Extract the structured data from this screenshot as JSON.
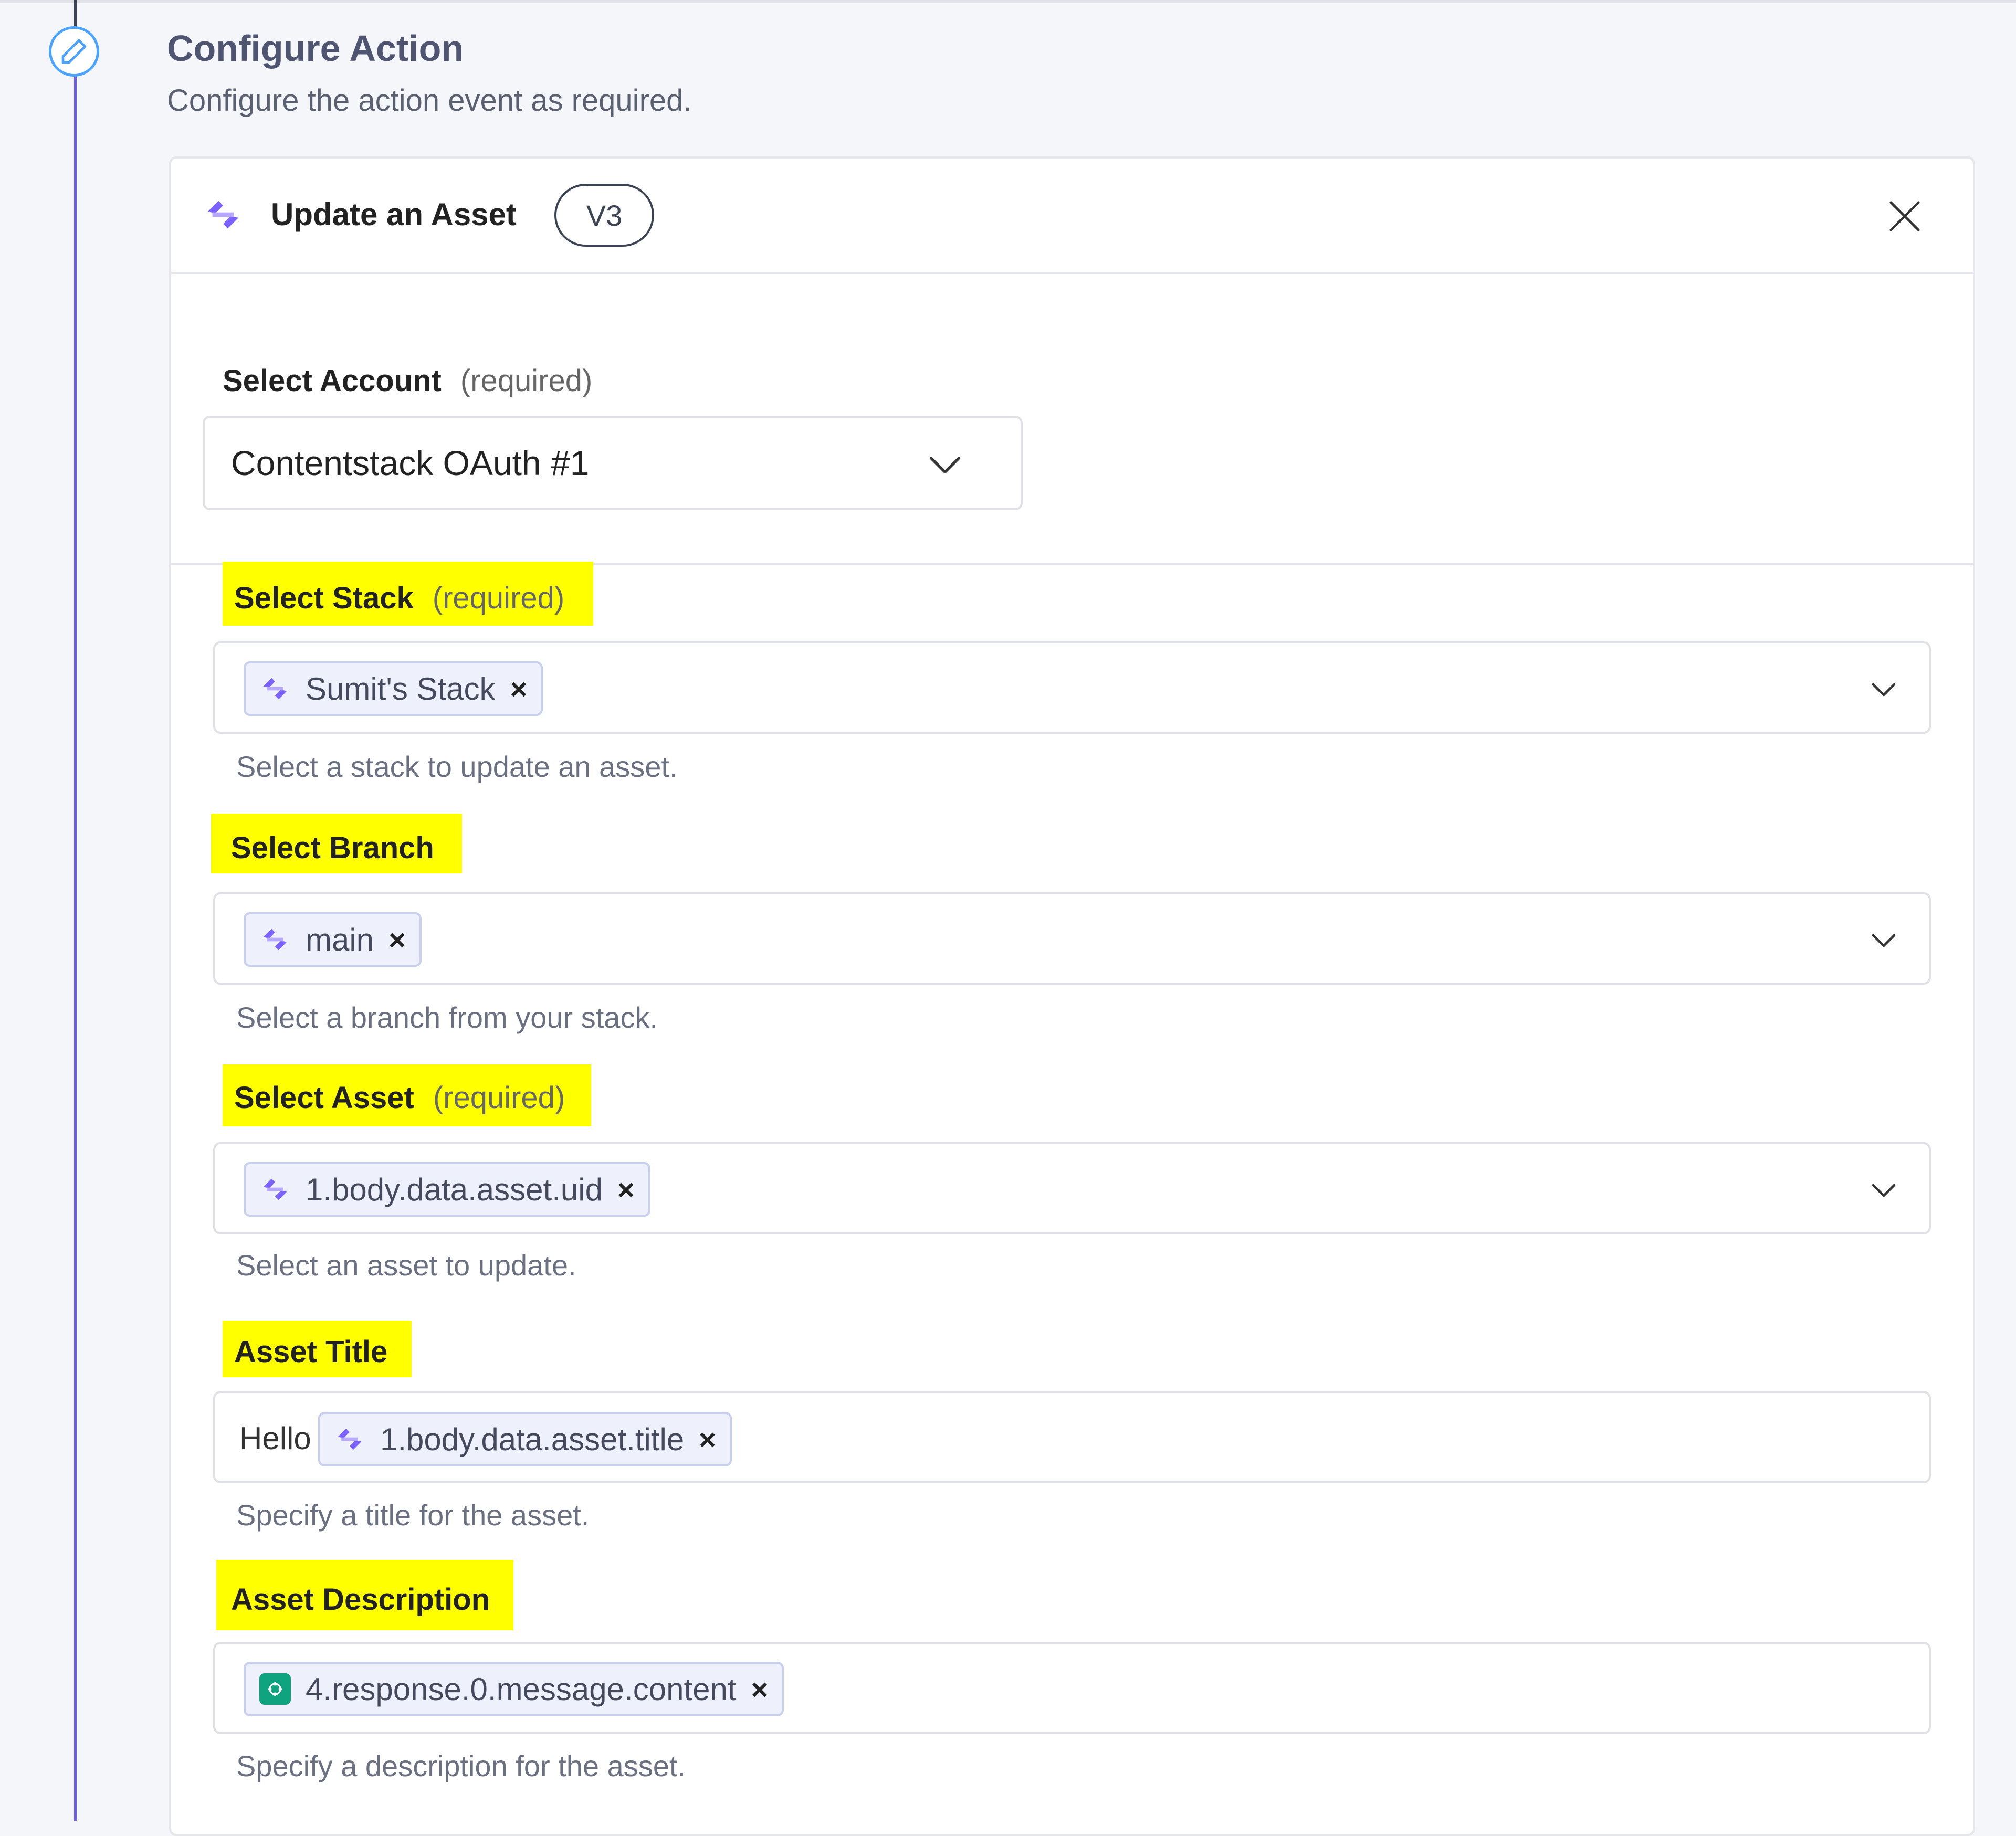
{
  "step": {
    "title": "Configure Action",
    "subtitle": "Configure the action event as required."
  },
  "card": {
    "title": "Update an Asset",
    "version": "V3"
  },
  "account": {
    "label": "Select Account",
    "required": "(required)",
    "value": "Contentstack OAuth #1"
  },
  "stack": {
    "label": "Select Stack",
    "required": "(required)",
    "chip": "Sumit's Stack",
    "help": "Select a stack to update an asset."
  },
  "branch": {
    "label": "Select Branch",
    "chip": "main",
    "help": "Select a branch from your stack."
  },
  "asset": {
    "label": "Select Asset",
    "required": "(required)",
    "chip": "1.body.data.asset.uid",
    "help": "Select an asset to update."
  },
  "asset_title": {
    "label": "Asset Title",
    "prefix": "Hello",
    "chip": "1.body.data.asset.title",
    "help": "Specify a title for the asset."
  },
  "asset_description": {
    "label": "Asset Description",
    "chip": "4.response.0.message.content",
    "help": "Specify a description for the asset."
  },
  "colors": {
    "accent": "#6c5ce7",
    "highlight": "#ffff00",
    "step_icon": "#4aa3ff",
    "openai_green": "#10a37f"
  },
  "icons": {
    "step": "pencil-icon",
    "app": "contentstack-icon",
    "close": "close-icon",
    "dropdown": "chevron-down-icon",
    "chip_remove": "close-small-icon",
    "openai": "openai-icon"
  }
}
